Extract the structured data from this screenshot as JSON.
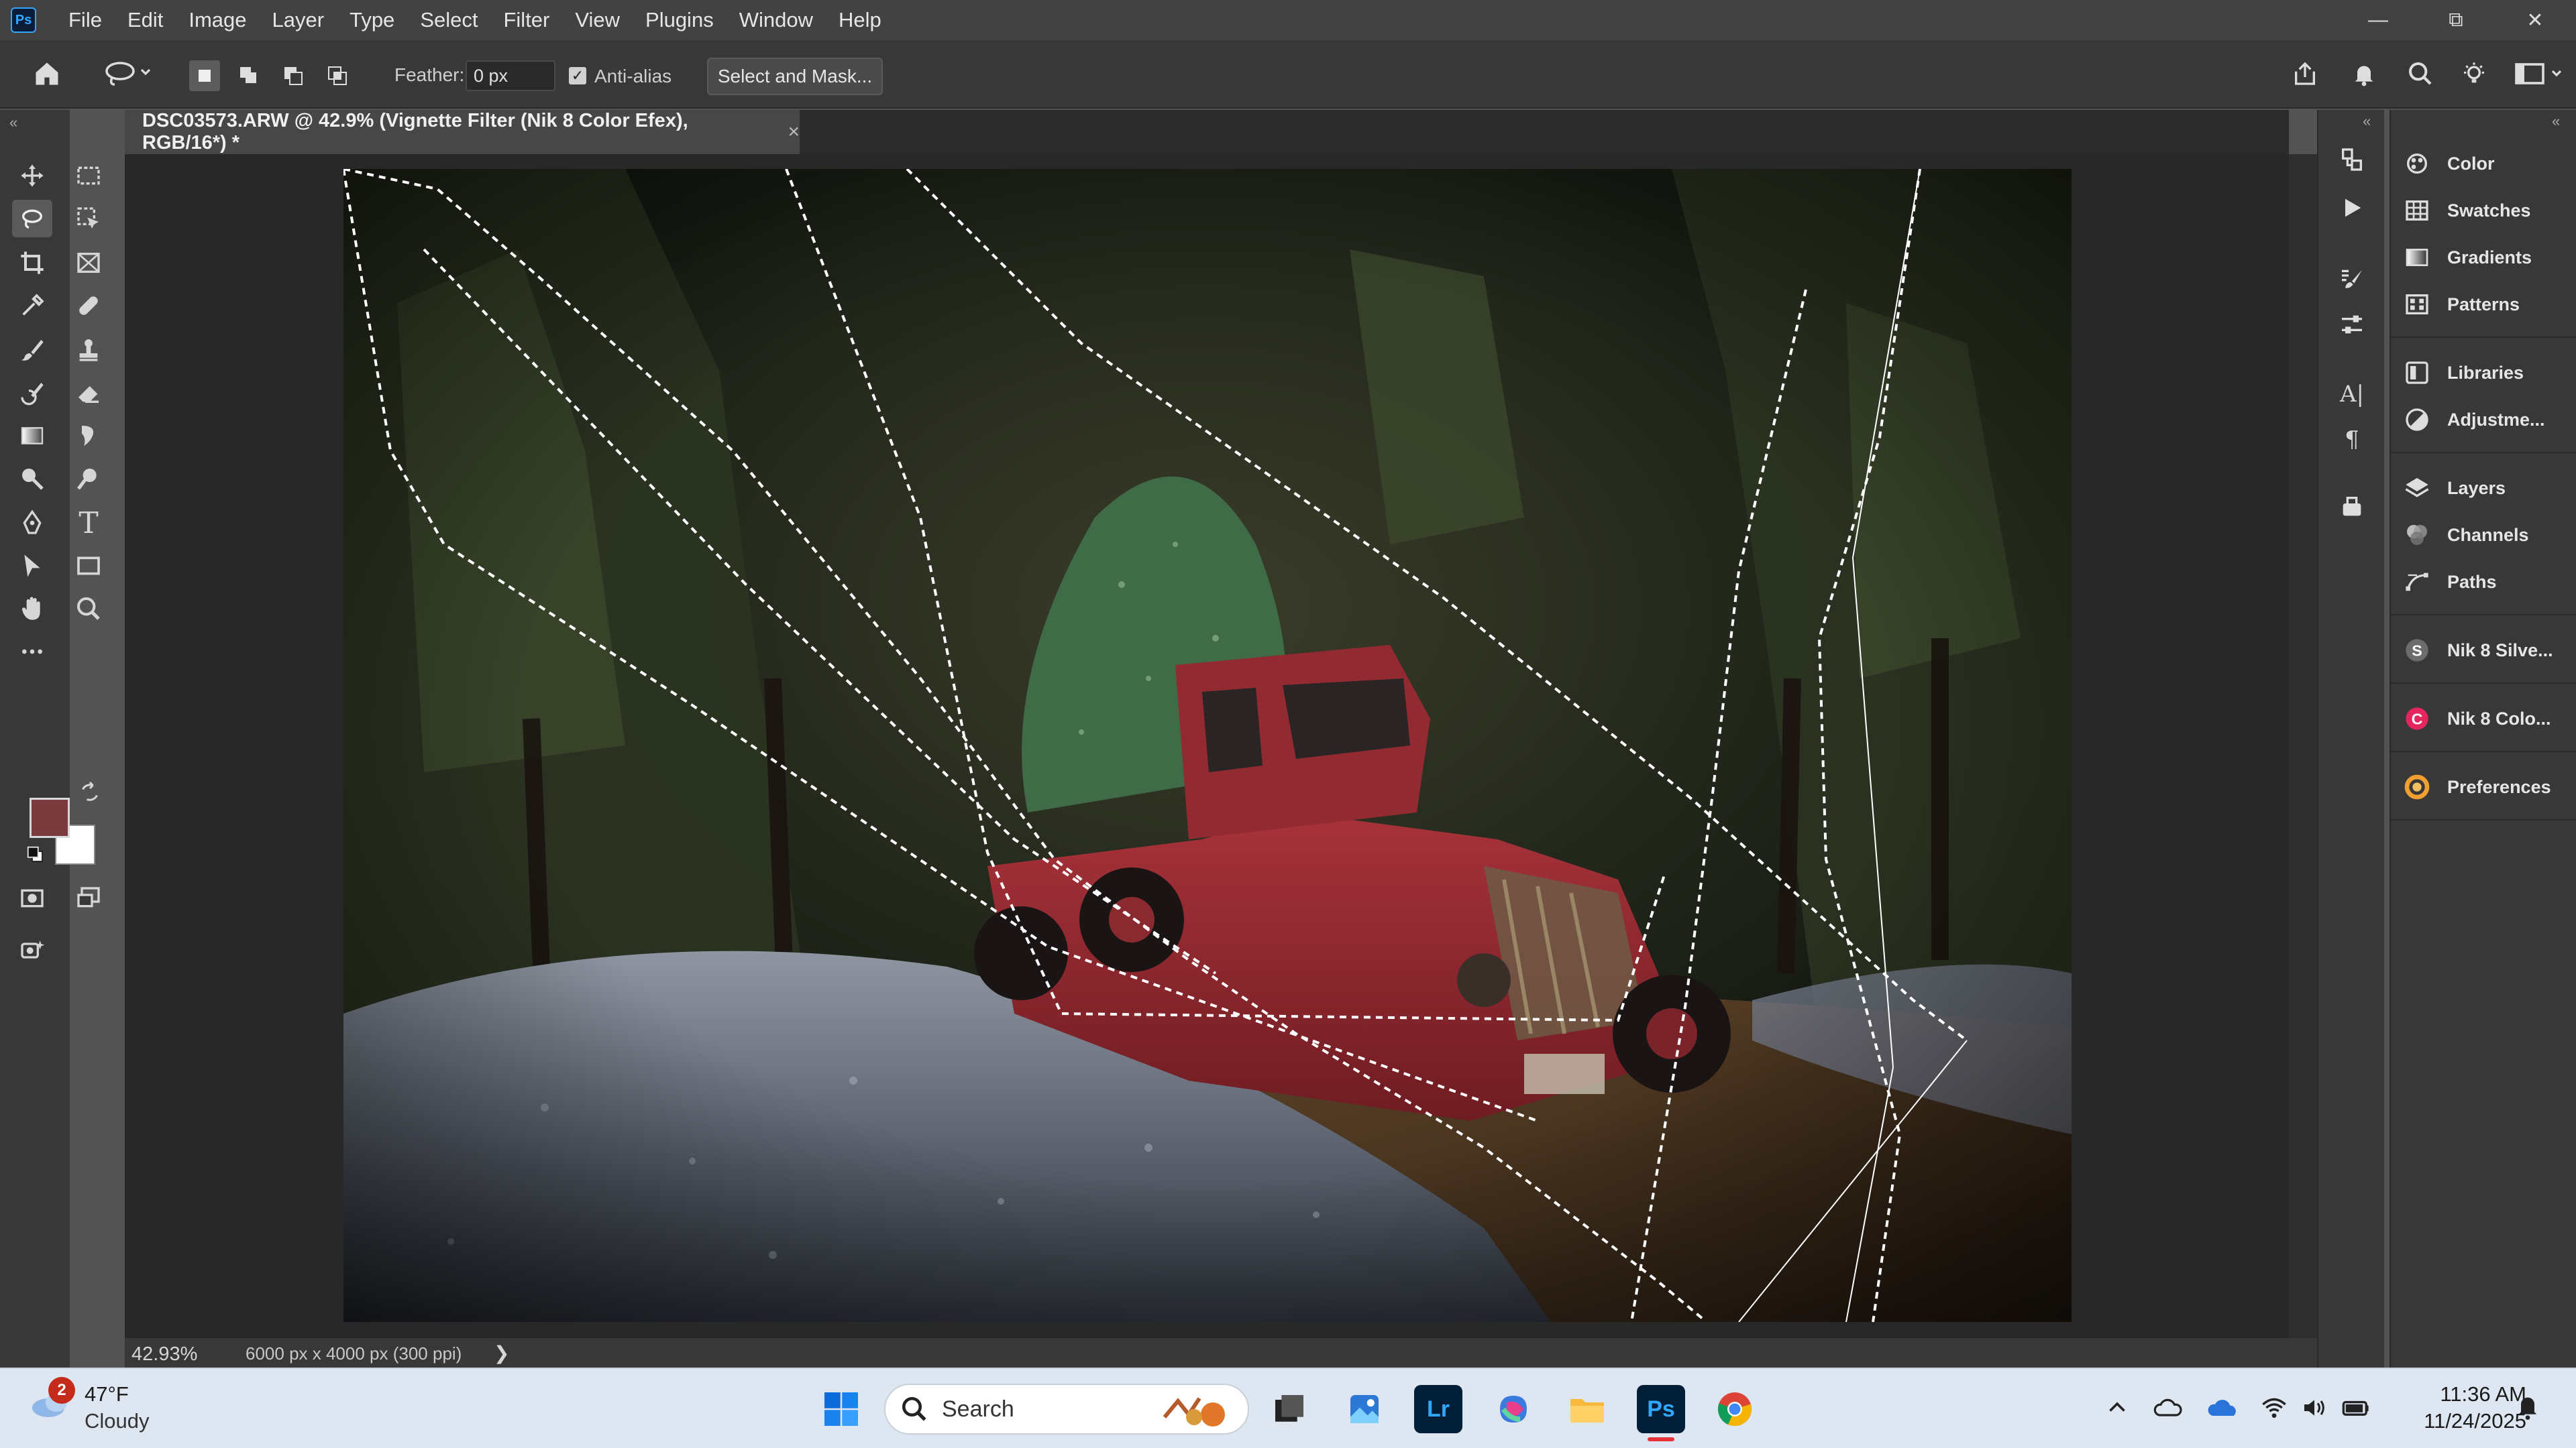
{
  "app": {
    "logo_text": "Ps",
    "menu": [
      "File",
      "Edit",
      "Image",
      "Layer",
      "Type",
      "Select",
      "Filter",
      "View",
      "Plugins",
      "Window",
      "Help"
    ]
  },
  "options_bar": {
    "feather_label": "Feather:",
    "feather_value": "0 px",
    "anti_alias_label": "Anti-alias",
    "anti_alias_checked": true,
    "select_and_mask_label": "Select and Mask..."
  },
  "document": {
    "tab_title": "DSC03573.ARW @ 42.9% (Vignette Filter (Nik 8 Color Efex), RGB/16*) *",
    "close_glyph": "×",
    "zoom": "42.93%",
    "info": "6000 px x 4000 px (300 ppi)",
    "status_arrow": "❯"
  },
  "colors": {
    "foreground": "#7b3a3e",
    "background": "#ffffff",
    "accent": "#31a8ff"
  },
  "panels": [
    {
      "label": "Color",
      "icon": "color-wheel-icon"
    },
    {
      "label": "Swatches",
      "icon": "swatches-grid-icon"
    },
    {
      "label": "Gradients",
      "icon": "gradient-icon"
    },
    {
      "label": "Patterns",
      "icon": "patterns-icon"
    },
    {
      "label": "Libraries",
      "icon": "libraries-icon"
    },
    {
      "label": "Adjustme...",
      "icon": "adjustments-icon"
    },
    {
      "label": "Layers",
      "icon": "layers-icon"
    },
    {
      "label": "Channels",
      "icon": "channels-icon"
    },
    {
      "label": "Paths",
      "icon": "paths-icon"
    },
    {
      "label": "Nik 8 Silve...",
      "icon": "nik-silver-icon"
    },
    {
      "label": "Nik 8 Colo...",
      "icon": "nik-color-icon"
    },
    {
      "label": "Preferences",
      "icon": "preferences-icon"
    }
  ],
  "taskbar": {
    "weather_temp": "47°F",
    "weather_desc": "Cloudy",
    "weather_badge": "2",
    "search_placeholder": "Search",
    "clock_time": "11:36 AM",
    "clock_date": "11/24/2025",
    "apps": [
      "windows-start",
      "search",
      "task-view",
      "photos",
      "lightroom",
      "m365",
      "file-explorer",
      "photoshop",
      "chrome"
    ],
    "lr_text": "Lr",
    "ps_text": "Ps"
  }
}
